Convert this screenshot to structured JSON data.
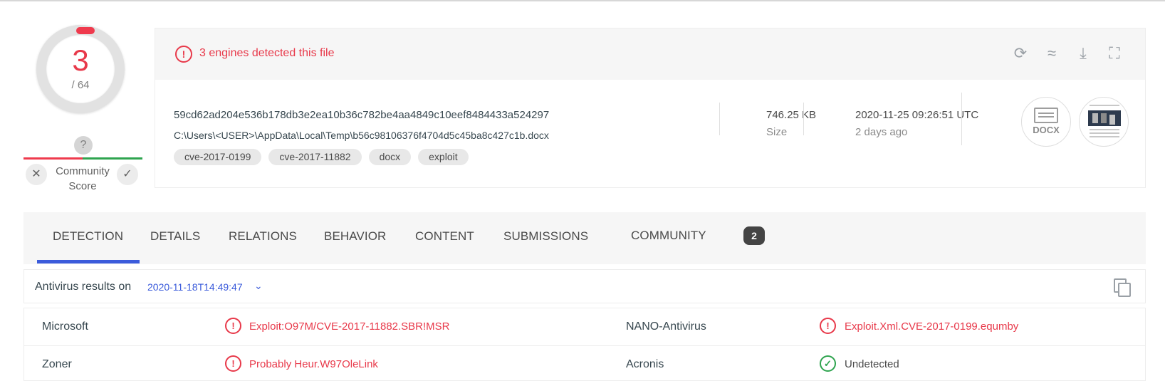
{
  "score": {
    "detected": "3",
    "total": "/ 64",
    "question": "?",
    "community_label": "Community Score",
    "vote_down": "✕",
    "vote_up": "✓"
  },
  "alert": {
    "icon": "!",
    "text": "3 engines detected this file"
  },
  "header_actions": [
    "reanalyze-icon",
    "similar-icon",
    "download-icon",
    "graph-icon"
  ],
  "file": {
    "hash": "59cd62ad204e536b178db3e2ea10b36c782be4aa4849c10eef8484433a524297",
    "path": "C:\\Users\\<USER>\\AppData\\Local\\Temp\\b56c98106376f4704d5c45ba8c427c1b.docx",
    "tags": [
      "cve-2017-0199",
      "cve-2017-11882",
      "docx",
      "exploit"
    ],
    "size": "746.25 KB",
    "size_label": "Size",
    "date": "2020-11-25 09:26:51 UTC",
    "date_ago": "2 days ago",
    "type_label": "DOCX"
  },
  "tabs": {
    "detection": "DETECTION",
    "details": "DETAILS",
    "relations": "RELATIONS",
    "behavior": "BEHAVIOR",
    "content": "CONTENT",
    "submissions": "SUBMISSIONS",
    "community": "COMMUNITY",
    "community_count": "2"
  },
  "av": {
    "title": "Antivirus results on",
    "date": "2020-11-18T14:49:47",
    "chevron": "⌄",
    "rows": [
      {
        "left_engine": "Microsoft",
        "left_result": "Exploit:O97M/CVE-2017-11882.SBR!MSR",
        "left_status": "!",
        "right_engine": "NANO-Antivirus",
        "right_result": "Exploit.Xml.CVE-2017-0199.equmby",
        "right_status": "!"
      },
      {
        "left_engine": "Zoner",
        "left_result": "Probably Heur.W97OleLink",
        "left_status": "!",
        "right_engine": "Acronis",
        "right_result": "Undetected",
        "right_status": "✓"
      }
    ]
  },
  "colors": {
    "danger": "#e8394a",
    "ok": "#2fa44f",
    "accent": "#3b5bdb"
  }
}
